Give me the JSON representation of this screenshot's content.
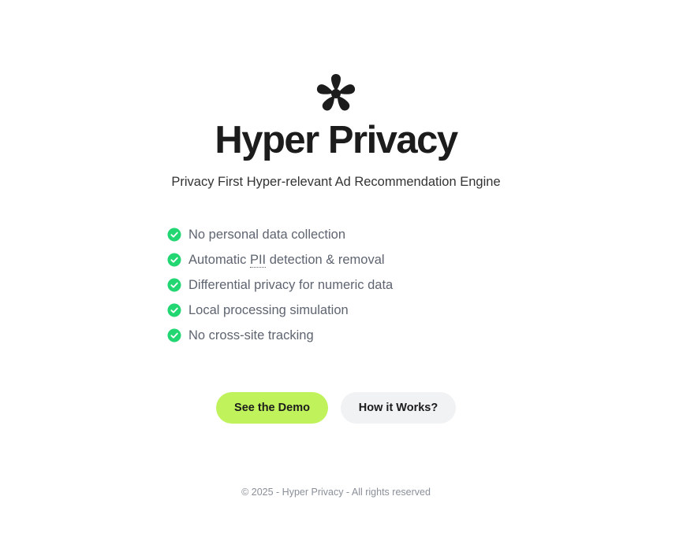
{
  "brand": {
    "logo_icon": "asterisk-flower-icon",
    "title": "Hyper Privacy",
    "subtitle": "Privacy First Hyper-relevant Ad Recommendation Engine"
  },
  "features": {
    "check_icon": "check-circle-icon",
    "check_color": "#22d672",
    "items": [
      {
        "label": "No personal data collection"
      },
      {
        "label_before": "Automatic ",
        "label_abbr": "PII",
        "label_after": " detection & removal"
      },
      {
        "label": "Differential privacy for numeric data"
      },
      {
        "label": "Local processing simulation"
      },
      {
        "label": "No cross-site tracking"
      }
    ]
  },
  "actions": {
    "demo_label": "See the Demo",
    "demo_color": "#c0f25c",
    "how_label": "How it Works?",
    "how_color": "#f1f2f4"
  },
  "footer": {
    "text": "© 2025 - Hyper Privacy - All rights reserved"
  }
}
